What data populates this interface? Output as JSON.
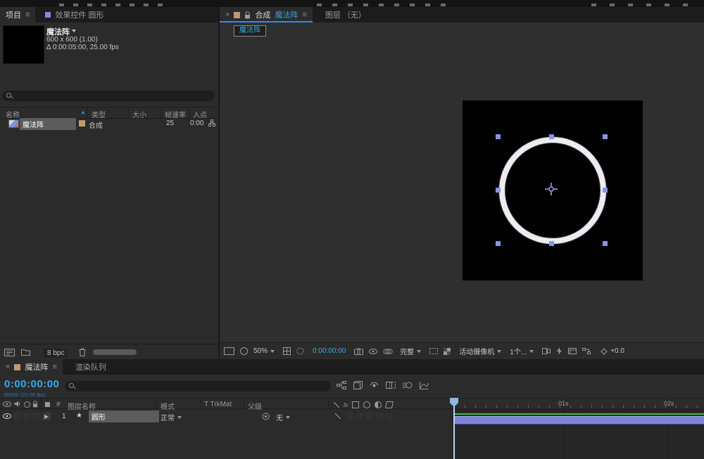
{
  "colors": {
    "accent_blue": "#2d8ceb",
    "tab_cyan": "#2fa8dc",
    "timecode_blue": "#35a8ec",
    "layer_bar": "#7a86d8",
    "cache_green": "#37c24f",
    "label_tan": "#c09a6a"
  },
  "glyphs": {
    "close": "×",
    "menu": "≡",
    "sort": "▲",
    "expander": "▶",
    "star": "★",
    "hash": "#"
  },
  "project_panel": {
    "tab_project": "项目",
    "tab_effect_controls": "效果控件 圆形",
    "comp_name": "魔法阵",
    "comp_dimensions": "600 x 600 (1.00)",
    "comp_duration": "Δ 0:00:05:00, 25.00 fps",
    "columns": {
      "name": "名称",
      "type": "类型",
      "size": "大小",
      "frame_rate": "帧速率",
      "in_point": "入点"
    },
    "row": {
      "name": "魔法阵",
      "type": "合成",
      "frame_rate": "25",
      "in_point": "0:00"
    },
    "footer": {
      "bpc": "8 bpc"
    }
  },
  "comp_panel": {
    "tab_composition": "合成",
    "tab_comp_name": "魔法阵",
    "tab_layer": "图层 （无）",
    "viewer_button": "魔法阵",
    "footer": {
      "zoom": "50%",
      "timecode": "0:00:00:00",
      "resolution": "完整",
      "camera": "活动摄像机",
      "views": "1个...",
      "exposure": "+0.0"
    }
  },
  "timeline_panel": {
    "tab_comp": "魔法阵",
    "tab_render_queue": "渲染队列",
    "timecode": "0:00:00:00",
    "frame_counter": "00000 (25.00 fps)",
    "columns": {
      "layer_name": "图层名称",
      "mode": "模式",
      "trkmat": "T TrkMat",
      "parent": "父级"
    },
    "layer": {
      "index": "1",
      "name": "圆形",
      "mode": "正常",
      "parent": "无"
    },
    "ruler": {
      "s1": "01s",
      "s2": "02s"
    }
  }
}
